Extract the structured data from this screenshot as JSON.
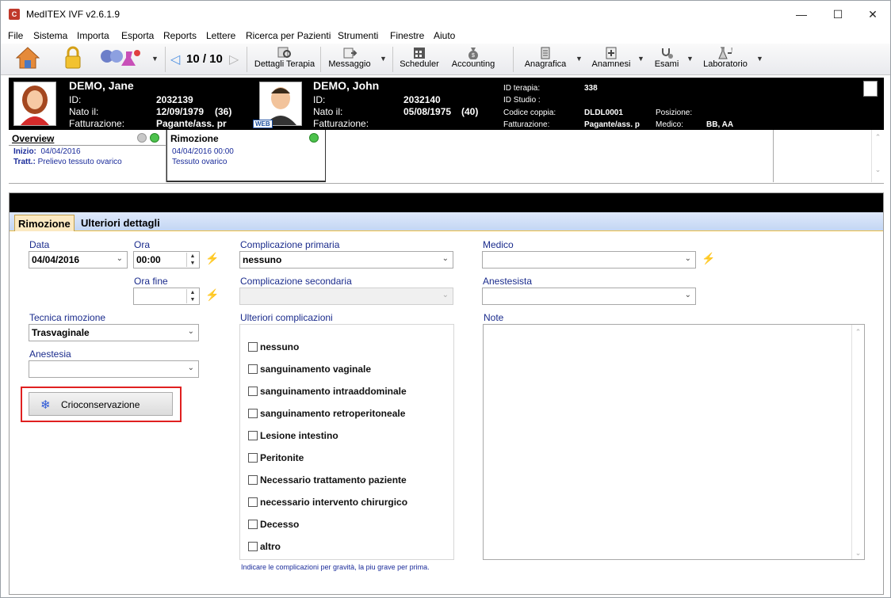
{
  "window": {
    "title": "MedITEX IVF v2.6.1.9",
    "app_icon": "meditex-logo-icon",
    "controls": [
      "minimize-icon",
      "maximize-icon",
      "close-icon"
    ]
  },
  "menu": [
    "File",
    "Sistema",
    "Importa",
    "Esporta",
    "Reports",
    "Lettere",
    "Ricerca per Pazienti",
    "Strumenti",
    "Finestre",
    "Aiuto"
  ],
  "toolbar": {
    "counter": "10 / 10",
    "items": {
      "dettagli": "Dettagli Terapia",
      "messaggio": "Messaggio",
      "scheduler": "Scheduler",
      "accounting": "Accounting",
      "anagrafica": "Anagrafica",
      "anamnesi": "Anamnesi",
      "esami": "Esami",
      "laboratorio": "Laboratorio"
    }
  },
  "patient": {
    "female": {
      "name": "DEMO, Jane",
      "id_label": "ID:",
      "id": "2032139",
      "born_label": "Nato il:",
      "born": "12/09/1979",
      "age": "(36)",
      "billing_label": "Fatturazione:",
      "billing": "Pagante/ass. pr"
    },
    "male": {
      "name": "DEMO, John",
      "id_label": "ID:",
      "id": "2032140",
      "born_label": "Nato il:",
      "born": "05/08/1975",
      "age": "(40)",
      "billing_label": "Fatturazione:",
      "web_badge": "WEB"
    },
    "info": {
      "therapy_label": "ID terapia:",
      "therapy_id": "338",
      "study_label": "ID Studio :",
      "couple_label": "Codice coppia:",
      "couple_code": "DLDL0001",
      "billing_label": "Fatturazione:",
      "billing": "Pagante/ass. p",
      "position_label": "Posizione:",
      "doctor_label": "Medico:",
      "doctor": "BB, AA"
    }
  },
  "steps": {
    "overview": {
      "title": "Overview",
      "start_label": "Inizio:",
      "start": "04/04/2016",
      "treat_label": "Tratt.:",
      "treat": "Prelievo tessuto ovarico"
    },
    "rimozione": {
      "title": "Rimozione",
      "datetime": "04/04/2016 00:00",
      "tissue": "Tessuto ovarico"
    }
  },
  "detail": {
    "tabs": [
      "Rimozione",
      "Ulteriori dettagli"
    ],
    "data_label": "Data",
    "data_value": "04/04/2016",
    "ora_label": "Ora",
    "ora_value": "00:00",
    "ora_fine_label": "Ora fine",
    "ora_fine_value": "",
    "tecnica_label": "Tecnica rimozione",
    "tecnica_value": "Trasvaginale",
    "anestesia_label": "Anestesia",
    "anestesia_value": "",
    "crio_button": "Crioconservazione",
    "compl_primaria_label": "Complicazione primaria",
    "compl_primaria_value": "nessuno",
    "compl_secondaria_label": "Complicazione secondaria",
    "compl_secondaria_value": "",
    "ulteriori_label": "Ulteriori complicazioni",
    "complications": [
      "nessuno",
      "sanguinamento vaginale",
      "sanguinamento intraaddominale",
      "sanguinamento retroperitoneale",
      "Lesione intestino",
      "Peritonite",
      "Necessario trattamento paziente",
      "necessario intervento chirurgico",
      "Decesso",
      "altro"
    ],
    "hint": "Indicare le complicazioni per gravità, la piu grave per prima.",
    "medico_label": "Medico",
    "medico_value": "",
    "anestesista_label": "Anestesista",
    "anestesista_value": "",
    "note_label": "Note",
    "note_value": ""
  },
  "colors": {
    "highlight": "#e02020",
    "label_blue": "#1a2b8c",
    "tab_active": "#fbe9c2"
  }
}
